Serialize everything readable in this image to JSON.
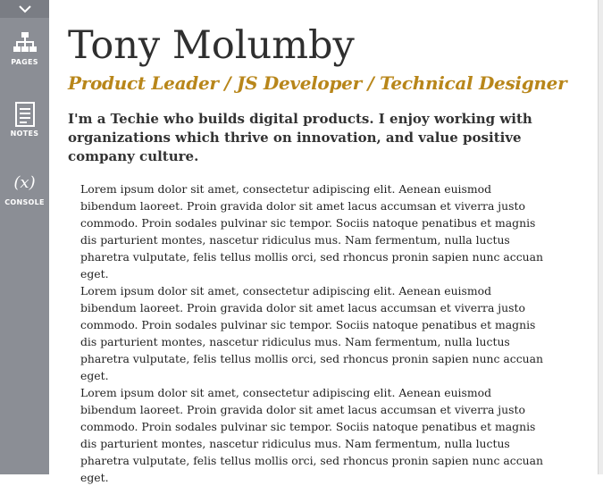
{
  "sidebar": {
    "items": [
      {
        "label": "PAGES",
        "icon": "sitemap-icon"
      },
      {
        "label": "NOTES",
        "icon": "notes-icon"
      },
      {
        "label": "CONSOLE",
        "icon": "console-icon",
        "glyph": "(x)"
      }
    ]
  },
  "profile": {
    "name": "Tony Molumby",
    "tagline": "Product Leader / JS Developer / Technical Designer",
    "intro": "I'm a Techie who builds digital products.  I enjoy working with organizations which thrive on innovation, and value positive company culture."
  },
  "paragraphs": [
    "Lorem ipsum dolor sit amet, consectetur adipiscing elit. Aenean euismod bibendum laoreet. Proin gravida dolor sit amet lacus accumsan et viverra justo commodo. Proin sodales pulvinar sic tempor. Sociis natoque penatibus et magnis dis parturient montes, nascetur ridiculus mus. Nam fermentum, nulla luctus pharetra vulputate, felis tellus mollis orci, sed rhoncus pronin sapien nunc accuan eget.",
    "Lorem ipsum dolor sit amet, consectetur adipiscing elit. Aenean euismod bibendum laoreet. Proin gravida dolor sit amet lacus accumsan et viverra justo commodo. Proin sodales pulvinar sic tempor. Sociis natoque penatibus et magnis dis parturient montes, nascetur ridiculus mus. Nam fermentum, nulla luctus pharetra vulputate, felis tellus mollis orci, sed rhoncus pronin sapien nunc accuan eget.",
    "Lorem ipsum dolor sit amet, consectetur adipiscing elit. Aenean euismod bibendum laoreet. Proin gravida dolor sit amet lacus accumsan et viverra justo commodo. Proin sodales pulvinar sic tempor. Sociis natoque penatibus et magnis dis parturient montes, nascetur ridiculus mus. Nam fermentum, nulla luctus pharetra vulputate, felis tellus mollis orci, sed rhoncus pronin sapien nunc accuan eget."
  ],
  "colors": {
    "sidebar": "#8b8e95",
    "accent": "#b8861a",
    "text": "#333333"
  }
}
